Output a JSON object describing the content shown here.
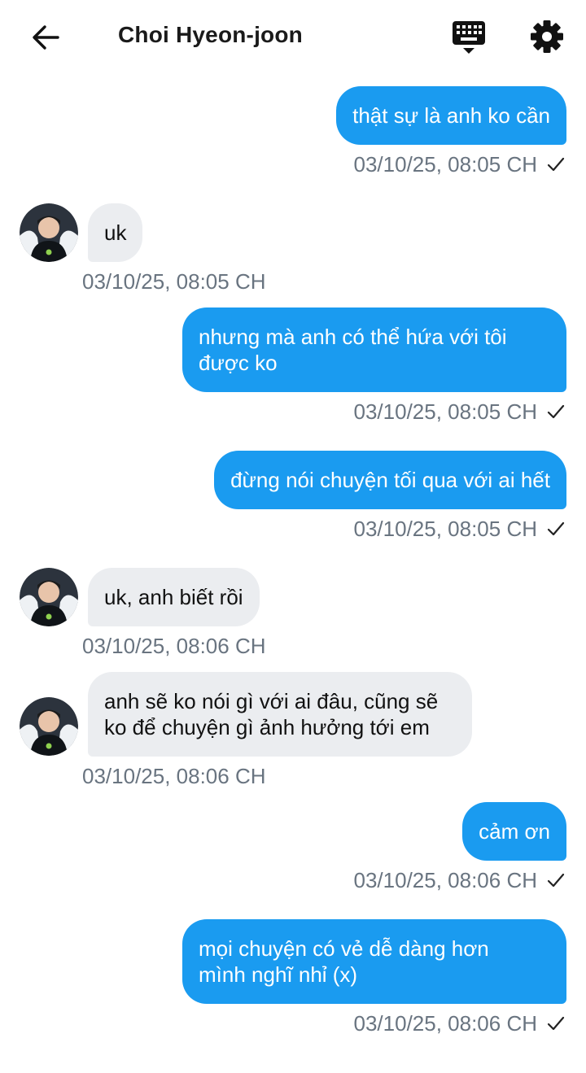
{
  "header": {
    "title": "Choi Hyeon-joon",
    "icons": [
      "arrow-left-icon",
      "keyboard-icon",
      "gear-icon"
    ]
  },
  "colors": {
    "sent_bubble": "#1a9bf0",
    "received_bubble": "#ebedf0",
    "timestamp": "#697480"
  },
  "messages": [
    {
      "direction": "sent",
      "text": "thật sự là anh ko cần",
      "time": "03/10/25, 08:05 CH"
    },
    {
      "direction": "received",
      "text": "uk",
      "time": "03/10/25, 08:05 CH"
    },
    {
      "direction": "sent",
      "text": "nhưng mà anh có thể hứa với tôi\nđược ko",
      "time": "03/10/25, 08:05 CH"
    },
    {
      "direction": "sent",
      "text": "đừng nói chuyện tối qua với ai hết",
      "time": "03/10/25, 08:05 CH"
    },
    {
      "direction": "received",
      "text": "uk, anh biết rồi",
      "time": "03/10/25, 08:06 CH"
    },
    {
      "direction": "received",
      "text": "anh sẽ ko nói gì với ai đâu, cũng sẽ\nko để chuyện gì ảnh hưởng tới em",
      "time": "03/10/25, 08:06 CH"
    },
    {
      "direction": "sent",
      "text": "cảm ơn",
      "time": "03/10/25, 08:06 CH"
    },
    {
      "direction": "sent",
      "text": "mọi chuyện có vẻ dễ dàng hơn\nmình nghĩ nhỉ (x)",
      "time": "03/10/25, 08:06 CH"
    }
  ]
}
